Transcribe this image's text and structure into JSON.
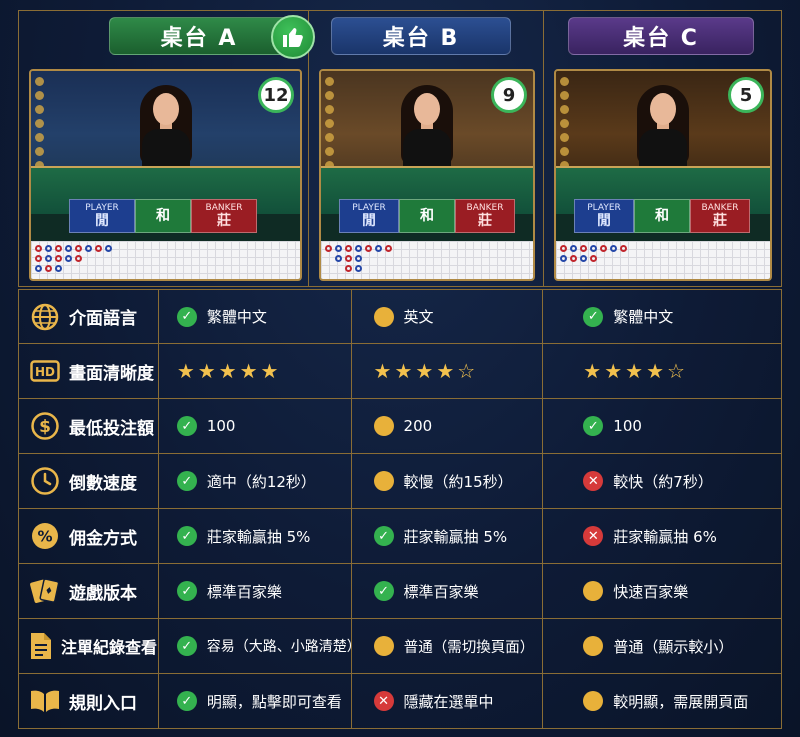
{
  "tables": [
    {
      "title": "桌台 A",
      "countdown": "12",
      "player_en": "PLAYER",
      "player_zh": "閒",
      "tie_zh": "和",
      "banker_en": "BANKER",
      "banker_zh": "莊"
    },
    {
      "title": "桌台 B",
      "countdown": "9",
      "player_en": "PLAYER",
      "player_zh": "閒",
      "tie_zh": "和",
      "banker_en": "BANKER",
      "banker_zh": "莊"
    },
    {
      "title": "桌台 C",
      "countdown": "5",
      "player_en": "PLAYER",
      "player_zh": "閒",
      "tie_zh": "和",
      "banker_en": "BANKER",
      "banker_zh": "莊"
    }
  ],
  "rows": [
    {
      "label": "介面語言",
      "icon": "globe-icon",
      "a": {
        "mark": "check",
        "text": "繁體中文"
      },
      "b": {
        "mark": "dot",
        "text": "英文"
      },
      "c": {
        "mark": "check",
        "text": "繁體中文"
      }
    },
    {
      "label": "畫面清晰度",
      "icon": "hd-icon",
      "a": {
        "stars": "★★★★★"
      },
      "b": {
        "stars": "★★★★☆"
      },
      "c": {
        "stars": "★★★★☆"
      }
    },
    {
      "label": "最低投注額",
      "icon": "dollar-icon",
      "a": {
        "mark": "check",
        "text": "100"
      },
      "b": {
        "mark": "dot",
        "text": "200"
      },
      "c": {
        "mark": "check",
        "text": "100"
      }
    },
    {
      "label": "倒數速度",
      "icon": "clock-icon",
      "a": {
        "mark": "check",
        "text": "適中（約12秒）"
      },
      "b": {
        "mark": "dot",
        "text": "較慢（約15秒）"
      },
      "c": {
        "mark": "cross",
        "text": "較快（約7秒）"
      }
    },
    {
      "label": "佣金方式",
      "icon": "percent-icon",
      "a": {
        "mark": "check",
        "text": "莊家輸贏抽 5%"
      },
      "b": {
        "mark": "check",
        "text": "莊家輸贏抽 5%"
      },
      "c": {
        "mark": "cross",
        "text": "莊家輸贏抽 6%"
      }
    },
    {
      "label": "遊戲版本",
      "icon": "cards-icon",
      "a": {
        "mark": "check",
        "text": "標準百家樂"
      },
      "b": {
        "mark": "check",
        "text": "標準百家樂"
      },
      "c": {
        "mark": "dot",
        "text": "快速百家樂"
      }
    },
    {
      "label": "注單紀錄查看",
      "icon": "document-icon",
      "a": {
        "mark": "check",
        "text": "容易（大路、小路清楚）"
      },
      "b": {
        "mark": "dot",
        "text": "普通（需切換頁面）"
      },
      "c": {
        "mark": "dot",
        "text": "普通（顯示較小）"
      }
    },
    {
      "label": "規則入口",
      "icon": "book-icon",
      "a": {
        "mark": "check",
        "text": "明顯，點擊即可查看"
      },
      "b": {
        "mark": "cross",
        "text": "隱藏在選單中"
      },
      "c": {
        "mark": "dot",
        "text": "較明顯，需展開頁面"
      }
    }
  ]
}
